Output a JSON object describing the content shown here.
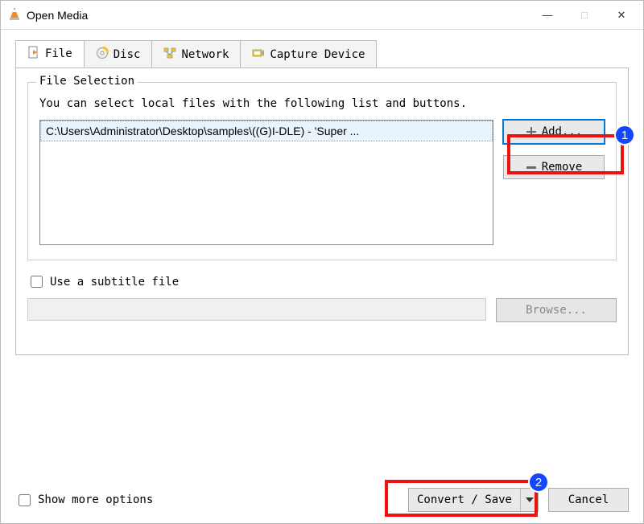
{
  "window": {
    "title": "Open Media"
  },
  "tabs": {
    "file": {
      "label": "File"
    },
    "disc": {
      "label": "Disc"
    },
    "network": {
      "label": "Network"
    },
    "capture": {
      "label": "Capture Device"
    }
  },
  "file_selection": {
    "legend": "File Selection",
    "hint": "You can select local files with the following list and buttons.",
    "files": [
      "C:\\Users\\Administrator\\Desktop\\samples\\((G)I-DLE) - 'Super ..."
    ],
    "add_label": "Add...",
    "remove_label": "Remove"
  },
  "subtitle": {
    "checkbox_label": "Use a subtitle file",
    "browse_label": "Browse..."
  },
  "footer": {
    "show_more_label": "Show more options",
    "convert_label": "Convert / Save",
    "cancel_label": "Cancel"
  },
  "callouts": {
    "one": "1",
    "two": "2"
  }
}
